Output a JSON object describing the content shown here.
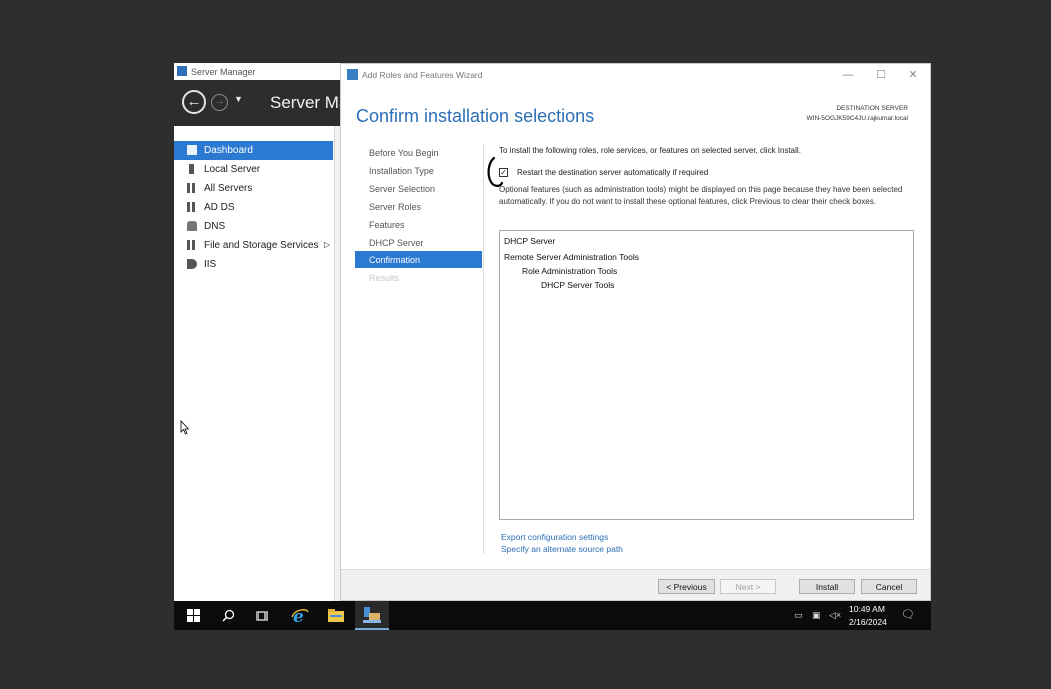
{
  "server_manager": {
    "window_title": "Server Manager",
    "header_title": "Server Ma",
    "nav": [
      {
        "label": "Dashboard",
        "icon": "dashboard-icon",
        "active": true
      },
      {
        "label": "Local Server",
        "icon": "server-icon",
        "active": false
      },
      {
        "label": "All Servers",
        "icon": "servers-icon",
        "active": false
      },
      {
        "label": "AD DS",
        "icon": "ad-ds-icon",
        "active": false
      },
      {
        "label": "DNS",
        "icon": "dns-icon",
        "active": false
      },
      {
        "label": "File and Storage Services",
        "icon": "storage-icon",
        "active": false,
        "expand": "▷"
      },
      {
        "label": "IIS",
        "icon": "iis-icon",
        "active": false
      }
    ]
  },
  "wizard": {
    "window_title": "Add Roles and Features Wizard",
    "heading": "Confirm installation selections",
    "destination_label": "DESTINATION SERVER",
    "destination_server": "WIN-5OGJK59C4JU.rajkumar.local",
    "steps": [
      {
        "label": "Before You Begin",
        "state": "normal"
      },
      {
        "label": "Installation Type",
        "state": "normal"
      },
      {
        "label": "Server Selection",
        "state": "normal"
      },
      {
        "label": "Server Roles",
        "state": "normal"
      },
      {
        "label": "Features",
        "state": "normal"
      },
      {
        "label": "DHCP Server",
        "state": "normal"
      },
      {
        "label": "Confirmation",
        "state": "active"
      },
      {
        "label": "Results",
        "state": "disabled"
      }
    ],
    "intro": "To install the following roles, role services, or features on selected server, click Install.",
    "restart_checkbox": {
      "label": "Restart the destination server automatically if required",
      "checked": true
    },
    "optional_text": "Optional features (such as administration tools) might be displayed on this page because they have been selected automatically. If you do not want to install these optional features, click Previous to clear their check boxes.",
    "items": [
      {
        "label": "DHCP Server",
        "level": 0
      },
      {
        "label": "Remote Server Administration Tools",
        "level": 0
      },
      {
        "label": "Role Administration Tools",
        "level": 1
      },
      {
        "label": "DHCP Server Tools",
        "level": 2
      }
    ],
    "links": {
      "export": "Export configuration settings",
      "alternate_source": "Specify an alternate source path"
    },
    "buttons": {
      "previous": "< Previous",
      "next": "Next >",
      "install": "Install",
      "cancel": "Cancel"
    },
    "window_controls": {
      "minimize": "—",
      "maximize": "☐",
      "close": "✕"
    }
  },
  "taskbar": {
    "clock_time": "10:49 AM",
    "clock_date": "2/16/2024",
    "icons": [
      "windows-start-icon",
      "search-icon",
      "task-view-icon",
      "internet-explorer-icon",
      "file-explorer-icon",
      "server-manager-icon"
    ]
  },
  "colors": {
    "accent": "#2b79d0",
    "heading": "#2b6fb6",
    "taskbar": "#0b0b0b",
    "desktop": "#2e2e2e"
  }
}
